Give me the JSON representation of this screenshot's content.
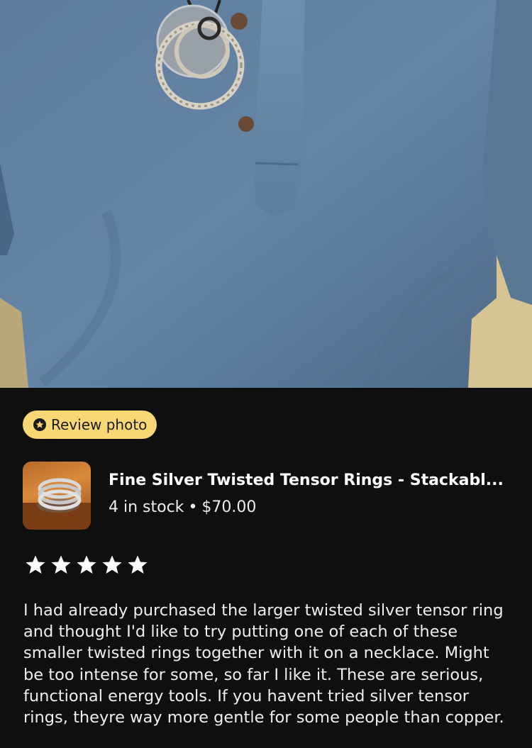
{
  "badge": {
    "label": "Review photo",
    "icon": "review-star-icon",
    "color": "#f8d874"
  },
  "product": {
    "title": "Fine Silver Twisted Tensor Rings - Stackabl...",
    "stock": "4 in stock",
    "separator": "•",
    "price": "$70.00"
  },
  "review": {
    "rating": 5,
    "max_rating": 5,
    "text": "I had already purchased the larger twisted silver tensor ring and thought I'd like to try putting one of each of these smaller twisted rings together with it on a necklace. Might be too intense for some, so far I like it. These are serious, functional energy tools. If you havent tried silver tensor rings, theyre way more gentle for some people than copper."
  },
  "colors": {
    "background": "#0f0f0f",
    "text": "#ffffff"
  }
}
